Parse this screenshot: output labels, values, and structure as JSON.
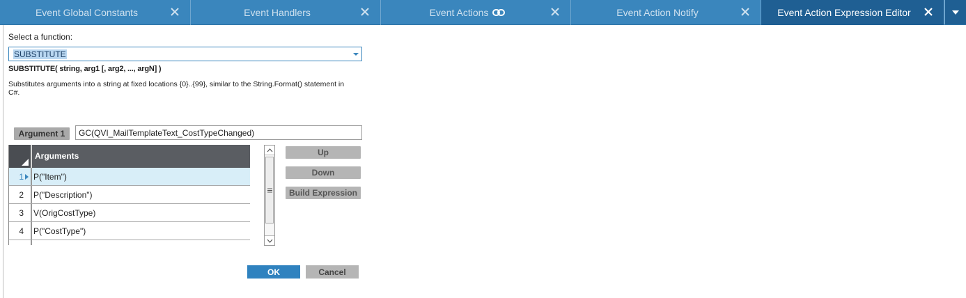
{
  "tabs": [
    {
      "label": "Event Global Constants",
      "active": false,
      "icon": null
    },
    {
      "label": "Event Handlers",
      "active": false,
      "icon": null
    },
    {
      "label": "Event Actions",
      "active": false,
      "icon": "link-icon"
    },
    {
      "label": "Event Action Notify",
      "active": false,
      "icon": null
    },
    {
      "label": "Event Action Expression Editor",
      "active": true,
      "icon": null
    }
  ],
  "editor": {
    "select_label": "Select a function:",
    "selected_function": "SUBSTITUTE",
    "signature": "SUBSTITUTE( string, arg1 [, arg2, ..., argN] )",
    "description": "Substitutes arguments into a string at fixed locations {0}..{99}, similar to the String.Format() statement in C#.",
    "argument_label": "Argument 1",
    "argument_value": "GC(QVI_MailTemplateText_CostTypeChanged)"
  },
  "grid": {
    "header": "Arguments",
    "rows": [
      {
        "num": "1",
        "value": "P(\"Item\")",
        "selected": true
      },
      {
        "num": "2",
        "value": "P(\"Description\")",
        "selected": false
      },
      {
        "num": "3",
        "value": "V(OrigCostType)",
        "selected": false
      },
      {
        "num": "4",
        "value": "P(\"CostType\")",
        "selected": false
      }
    ]
  },
  "side_buttons": {
    "up": "Up",
    "down": "Down",
    "build": "Build Expression"
  },
  "footer": {
    "ok": "OK",
    "cancel": "Cancel"
  },
  "colors": {
    "tab_bar": "#3a86bd",
    "active_tab": "#1f5f93",
    "selected_row": "#d8eef8",
    "ok_button": "#2f82bf"
  }
}
